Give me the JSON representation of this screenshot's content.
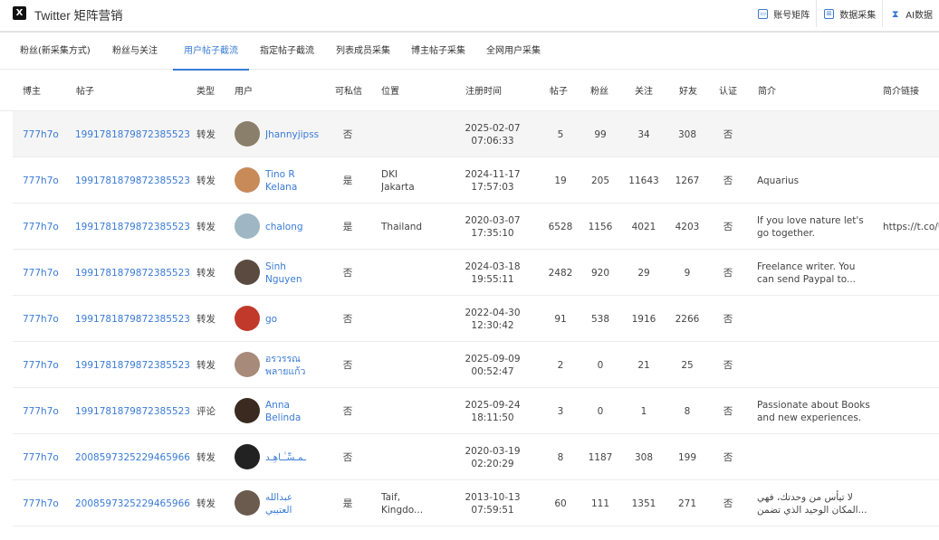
{
  "app": {
    "title": "Twitter 矩阵营销",
    "logo_glyph": "X"
  },
  "top_actions": [
    {
      "label": "账号矩阵",
      "icon": "id-card-icon"
    },
    {
      "label": "数据采集",
      "icon": "grid-icon"
    },
    {
      "label": "AI数据",
      "icon": "hourglass-icon"
    }
  ],
  "tabs": [
    {
      "label": "粉丝(新采集方式)",
      "active": false
    },
    {
      "label": "粉丝与关注",
      "active": false
    },
    {
      "label": "用户帖子截流",
      "active": true
    },
    {
      "label": "指定帖子截流",
      "active": false
    },
    {
      "label": "列表成员采集",
      "active": false
    },
    {
      "label": "博主帖子采集",
      "active": false
    },
    {
      "label": "全网用户采集",
      "active": false
    }
  ],
  "table": {
    "columns": {
      "blogger": "博主",
      "post": "帖子",
      "type": "类型",
      "user": "用户",
      "dm": "可私信",
      "location": "位置",
      "reg_time": "注册时间",
      "posts": "帖子",
      "followers": "粉丝",
      "following": "关注",
      "friends": "好友",
      "verified": "认证",
      "bio": "简介",
      "bio_link": "简介链接"
    },
    "rows": [
      {
        "blogger": "777h7o",
        "post": "1991781879872385523",
        "type": "转发",
        "user_line1": "Jhannyjipss",
        "user_line2": "",
        "dm": "否",
        "loc_line1": "",
        "loc_line2": "",
        "reg_date": "2025-02-07",
        "reg_time": "07:06:33",
        "posts": "5",
        "followers": "99",
        "following": "34",
        "friends": "308",
        "verified": "否",
        "bio_line1": "",
        "bio_line2": "",
        "bio_link": "",
        "avatar_color": "#8a7f6a"
      },
      {
        "blogger": "777h7o",
        "post": "1991781879872385523",
        "type": "转发",
        "user_line1": "Tino R",
        "user_line2": "Kelana",
        "dm": "是",
        "loc_line1": "DKI",
        "loc_line2": "Jakarta",
        "reg_date": "2024-11-17",
        "reg_time": "17:57:03",
        "posts": "19",
        "followers": "205",
        "following": "11643",
        "friends": "1267",
        "verified": "否",
        "bio_line1": "Aquarius",
        "bio_line2": "",
        "bio_link": "",
        "avatar_color": "#c98a5a"
      },
      {
        "blogger": "777h7o",
        "post": "1991781879872385523",
        "type": "转发",
        "user_line1": "chalong",
        "user_line2": "",
        "dm": "是",
        "loc_line1": "Thailand",
        "loc_line2": "",
        "reg_date": "2020-03-07",
        "reg_time": "17:35:10",
        "posts": "6528",
        "followers": "1156",
        "following": "4021",
        "friends": "4203",
        "verified": "否",
        "bio_line1": "If you love nature let's",
        "bio_line2": "go together.",
        "bio_link": "https://t.co/U",
        "avatar_color": "#9fb7c4"
      },
      {
        "blogger": "777h7o",
        "post": "1991781879872385523",
        "type": "转发",
        "user_line1": "Sinh",
        "user_line2": "Nguyen",
        "dm": "否",
        "loc_line1": "",
        "loc_line2": "",
        "reg_date": "2024-03-18",
        "reg_time": "19:55:11",
        "posts": "2482",
        "followers": "920",
        "following": "29",
        "friends": "9",
        "verified": "否",
        "bio_line1": "Freelance writer. You",
        "bio_line2": "can send Paypal to...",
        "bio_link": "",
        "avatar_color": "#5a4a40"
      },
      {
        "blogger": "777h7o",
        "post": "1991781879872385523",
        "type": "转发",
        "user_line1": "go",
        "user_line2": "",
        "dm": "否",
        "loc_line1": "",
        "loc_line2": "",
        "reg_date": "2022-04-30",
        "reg_time": "12:30:42",
        "posts": "91",
        "followers": "538",
        "following": "1916",
        "friends": "2266",
        "verified": "否",
        "bio_line1": "",
        "bio_line2": "",
        "bio_link": "",
        "avatar_color": "#c0392b"
      },
      {
        "blogger": "777h7o",
        "post": "1991781879872385523",
        "type": "转发",
        "user_line1": "อรวรรณ",
        "user_line2": "พลายแก้ว",
        "dm": "否",
        "loc_line1": "",
        "loc_line2": "",
        "reg_date": "2025-09-09",
        "reg_time": "00:52:47",
        "posts": "2",
        "followers": "0",
        "following": "21",
        "friends": "25",
        "verified": "否",
        "bio_line1": "",
        "bio_line2": "",
        "bio_link": "",
        "avatar_color": "#a88a7a"
      },
      {
        "blogger": "777h7o",
        "post": "1991781879872385523",
        "type": "评论",
        "user_line1": "Anna",
        "user_line2": "Belinda",
        "dm": "否",
        "loc_line1": "",
        "loc_line2": "",
        "reg_date": "2025-09-24",
        "reg_time": "18:11:50",
        "posts": "3",
        "followers": "0",
        "following": "1",
        "friends": "8",
        "verified": "否",
        "bio_line1": "Passionate about Books",
        "bio_line2": "and new experiences.",
        "bio_link": "",
        "avatar_color": "#3a2a20"
      },
      {
        "blogger": "777h7o",
        "post": "2008597325229465966",
        "type": "转发",
        "user_line1": "ـمـسِّـٰـاهِـد",
        "user_line2": "",
        "dm": "否",
        "loc_line1": "",
        "loc_line2": "",
        "reg_date": "2020-03-19",
        "reg_time": "02:20:29",
        "posts": "8",
        "followers": "1187",
        "following": "308",
        "friends": "199",
        "verified": "否",
        "bio_line1": "",
        "bio_line2": "",
        "bio_link": "",
        "avatar_color": "#222222"
      },
      {
        "blogger": "777h7o",
        "post": "2008597325229465966",
        "type": "转发",
        "user_line1": "عبدالله",
        "user_line2": "العتيبي",
        "dm": "是",
        "loc_line1": "Taif,",
        "loc_line2": "Kingdo...",
        "reg_date": "2013-10-13",
        "reg_time": "07:59:51",
        "posts": "60",
        "followers": "111",
        "following": "1351",
        "friends": "271",
        "verified": "否",
        "bio_line1": "لا تيأس من وحدتك، فهي",
        "bio_line2": "المكان الوحيد الذي تضمن...",
        "bio_link": "",
        "avatar_color": "#6b5a4e"
      }
    ]
  }
}
